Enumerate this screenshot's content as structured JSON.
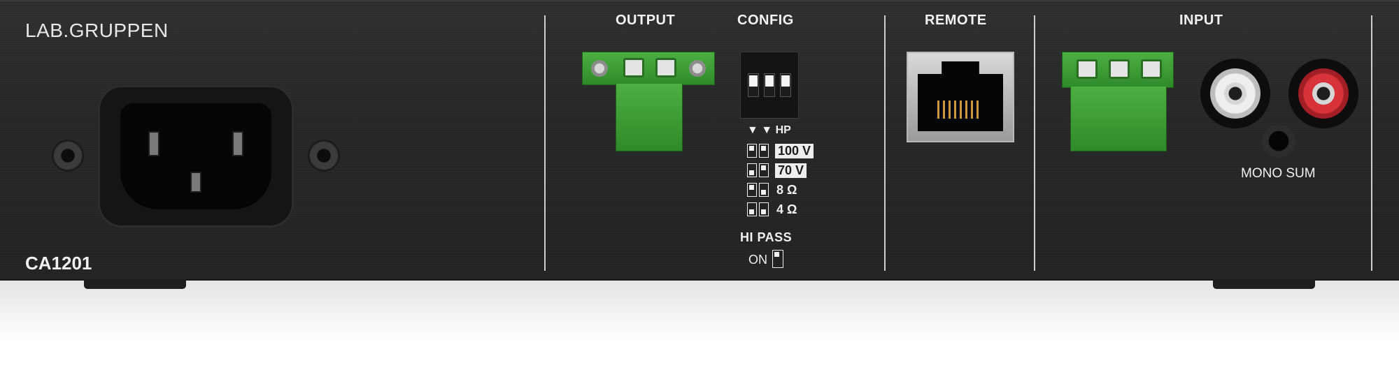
{
  "brand": "LAB.GRUPPEN",
  "model": "CA1201",
  "sections": {
    "output": "OUTPUT",
    "config": "CONFIG",
    "remote": "REMOTE",
    "input": "INPUT"
  },
  "config": {
    "hp_label": "▼ ▼ HP",
    "settings": [
      "100 V",
      "70 V",
      "8 Ω",
      "4 Ω"
    ],
    "hi_pass_label": "HI PASS",
    "hi_pass_on": "ON"
  },
  "input": {
    "mono_sum": "MONO SUM"
  },
  "colors": {
    "panel": "#262626",
    "terminal_green": "#3ea237",
    "rca_red": "#d8323a",
    "label": "#f2f2f2"
  }
}
